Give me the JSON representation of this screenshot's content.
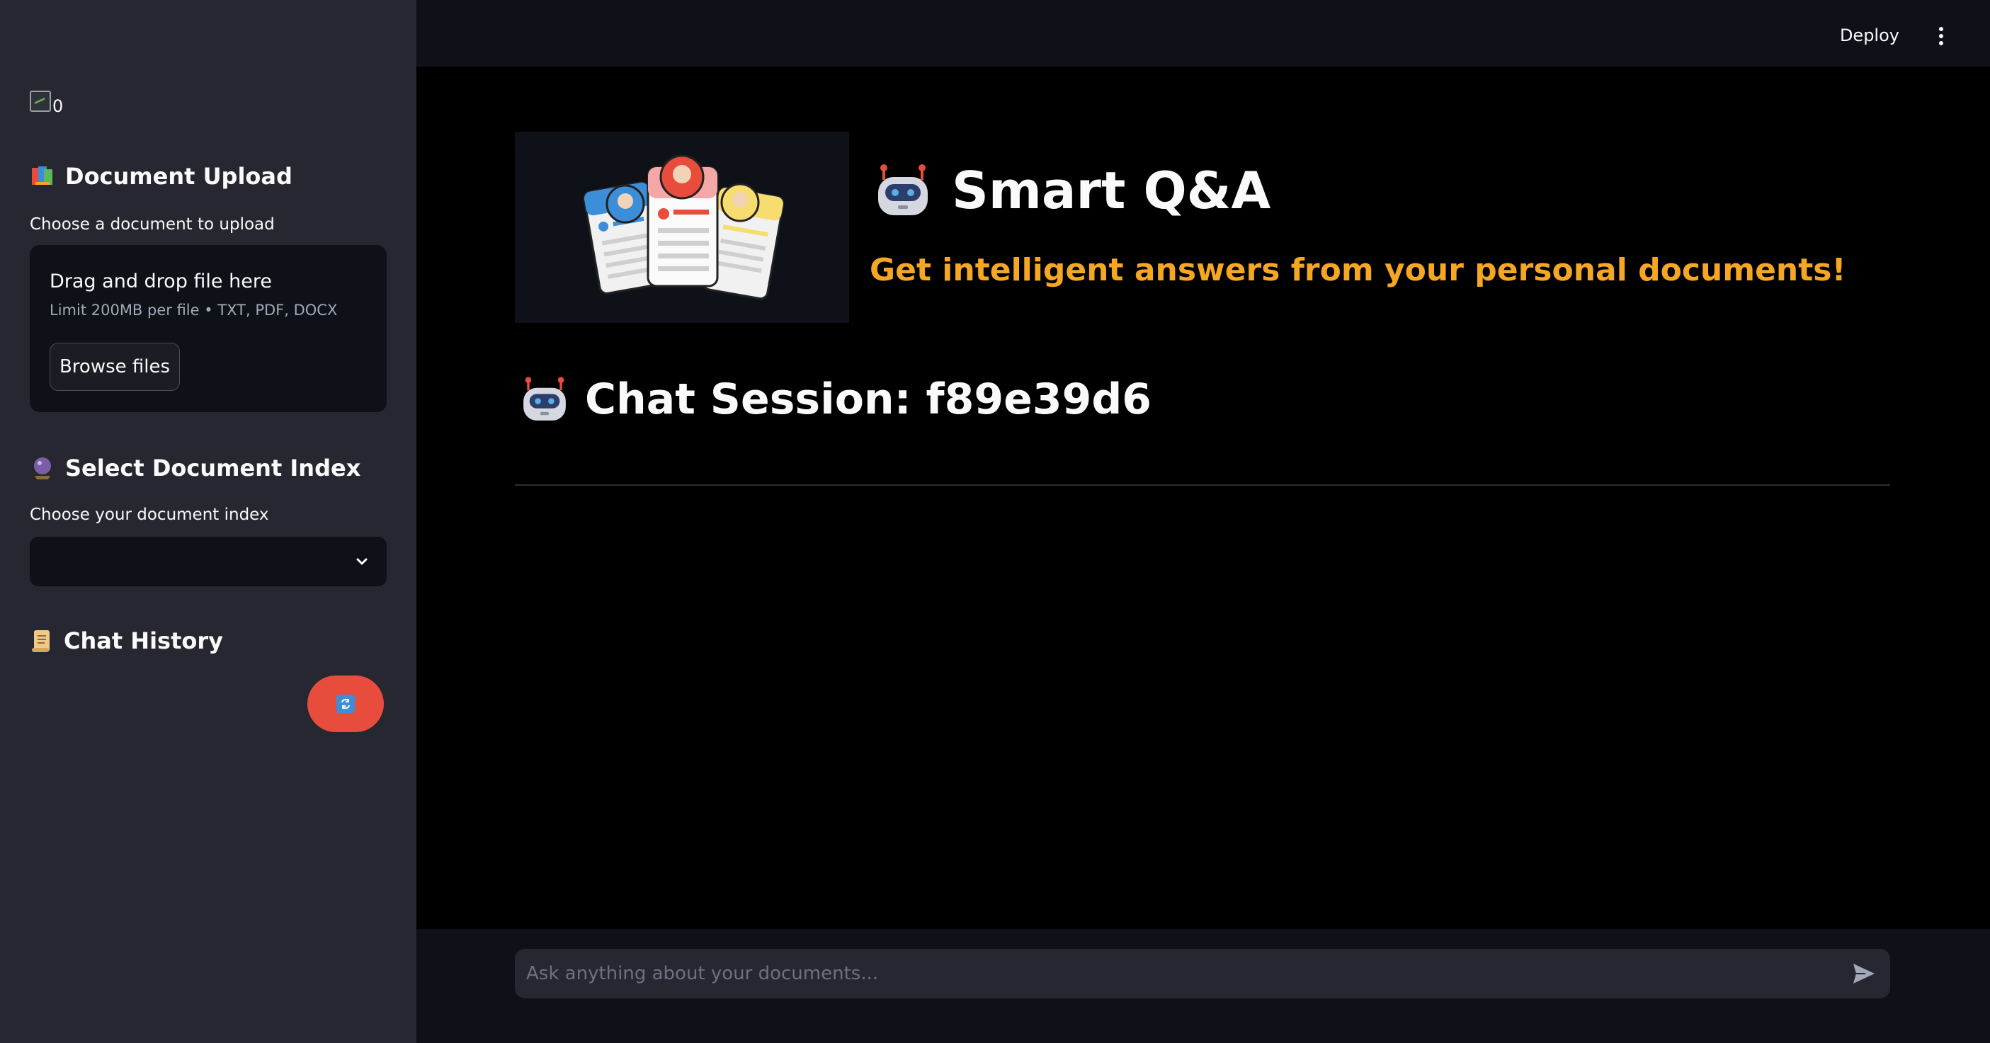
{
  "sidebar": {
    "logo_alt": "0",
    "upload": {
      "heading": "Document Upload",
      "label": "Choose a document to upload",
      "drop_title": "Drag and drop file here",
      "limit": "Limit 200MB per file • TXT, PDF, DOCX",
      "browse_label": "Browse files"
    },
    "index": {
      "heading": "Select Document Index",
      "label": "Choose your document index",
      "selected_value": ""
    },
    "history": {
      "heading": "Chat History"
    }
  },
  "header": {
    "deploy_label": "Deploy"
  },
  "main": {
    "title": "Smart Q&A",
    "subtitle": "Get intelligent answers from your personal documents!",
    "session_title": "Chat Session: f89e39d6"
  },
  "chat": {
    "placeholder": "Ask anything about your documents..."
  },
  "colors": {
    "sidebar_bg": "#262730",
    "main_bg": "#000000",
    "accent_orange": "#f5a623",
    "refresh_button": "#e74c3c"
  }
}
